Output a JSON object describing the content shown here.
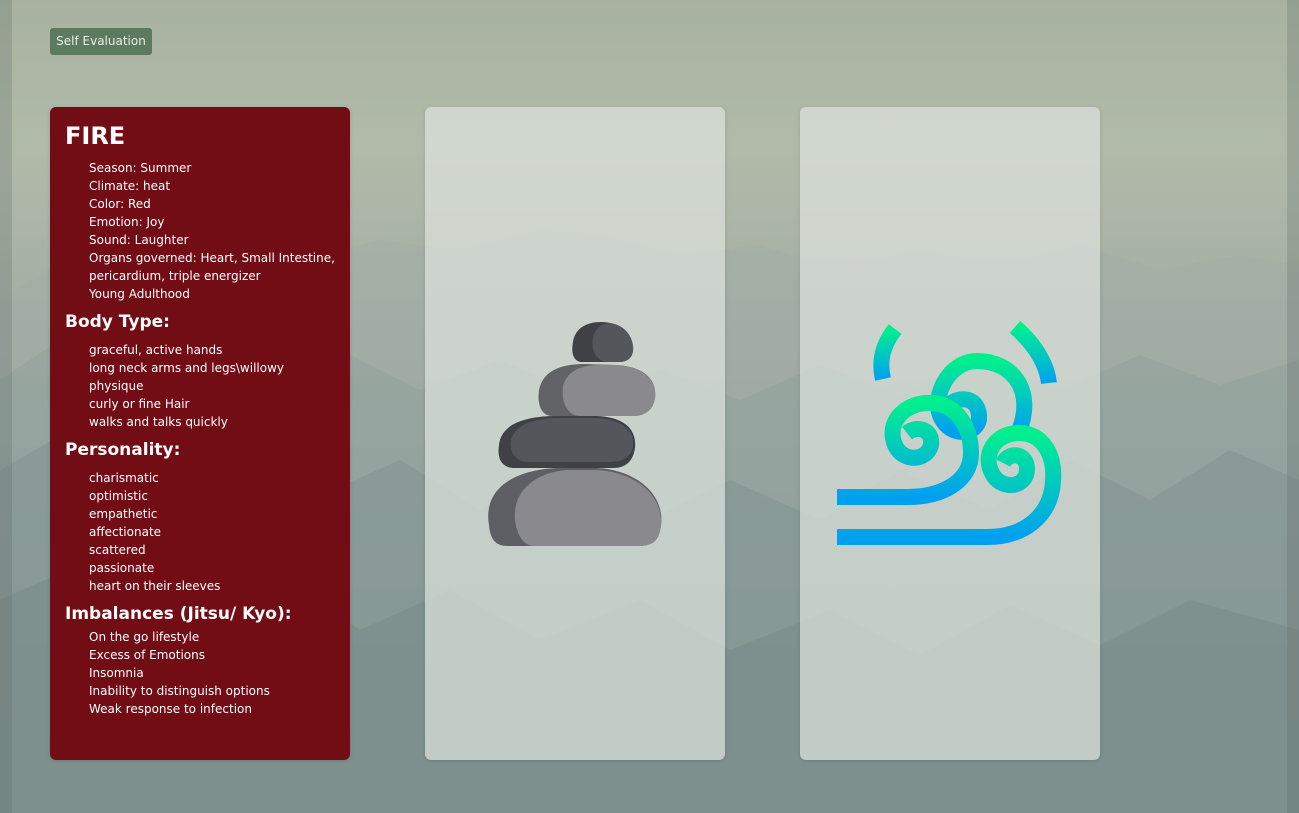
{
  "toolbar": {
    "self_eval_label": "Self Evaluation"
  },
  "element": {
    "title": "FIRE",
    "attributes": [
      "Season: Summer",
      "Climate: heat",
      "Color: Red",
      "Emotion: Joy",
      "Sound: Laughter",
      "Organs governed: Heart, Small Intestine,",
      "pericardium, triple energizer",
      "Young Adulthood"
    ],
    "body_type": {
      "heading": "Body Type:",
      "items": [
        "graceful, active hands",
        "long neck arms and legs\\willowy",
        "physique",
        "curly or fine Hair",
        "walks and talks quickly"
      ]
    },
    "personality": {
      "heading": "Personality:",
      "items": [
        "charismatic",
        "optimistic",
        "empathetic",
        "affectionate",
        "scattered",
        "passionate",
        "heart on their sleeves"
      ]
    },
    "imbalances": {
      "heading": "Imbalances (Jitsu/ Kyo):",
      "items": [
        "On the go lifestyle",
        "Excess of Emotions",
        "Insomnia",
        "Inability to distinguish options",
        "Weak response to infection"
      ]
    }
  },
  "cards": {
    "stone_icon": "stacked-stones-icon",
    "wind_icon": "wind-swirl-icon"
  },
  "colors": {
    "fire_red": "#730d15",
    "button_green": "#5e7a5e",
    "wind_green": "#00e68a",
    "wind_blue": "#00a0f0",
    "stone_dark": "#4c4e52",
    "stone_light": "#8a898e"
  }
}
